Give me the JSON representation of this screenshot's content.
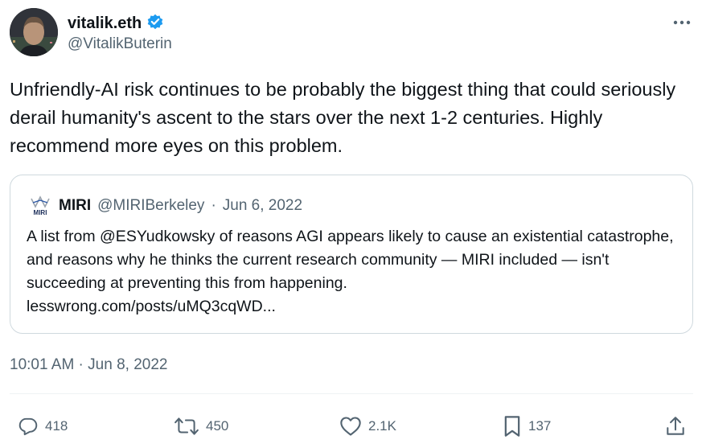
{
  "author": {
    "display_name": "vitalik.eth",
    "handle": "@VitalikButerin",
    "verified": true
  },
  "tweet": {
    "text": "Unfriendly-AI risk continues to be probably the biggest thing that could seriously derail humanity's ascent to the stars over the next 1-2 centuries. Highly recommend more eyes on this problem.",
    "timestamp": "10:01 AM · Jun 8, 2022"
  },
  "quote": {
    "logo_text": "MIRI",
    "name": "MIRI",
    "handle": "@MIRIBerkeley",
    "separator": "·",
    "date": "Jun 6, 2022",
    "text": "A list from @ESYudkowsky of reasons AGI appears likely to cause an existential catastrophe, and reasons why he thinks the current research community — MIRI included — isn't succeeding at preventing this from happening.",
    "link": "lesswrong.com/posts/uMQ3cqWD..."
  },
  "actions": {
    "replies": "418",
    "retweets": "450",
    "likes": "2.1K",
    "bookmarks": "137"
  },
  "colors": {
    "primary_text": "#0f1419",
    "secondary_text": "#536471",
    "verified_blue": "#1d9bf0",
    "border": "#cfd9de"
  },
  "icons": [
    "more-icon",
    "verified-badge-icon",
    "reply-icon",
    "retweet-icon",
    "like-icon",
    "bookmark-icon",
    "share-icon"
  ]
}
